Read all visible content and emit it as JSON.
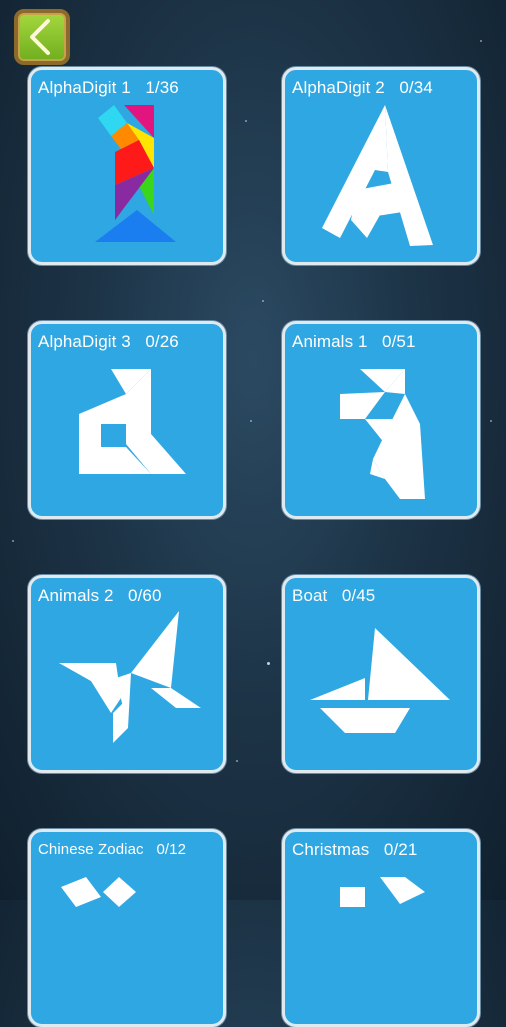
{
  "header": {
    "back_icon": "chevron-left-icon"
  },
  "colors": {
    "card_bg": "#2ea7e2",
    "accent_green": "#7fbf2a"
  },
  "packs": [
    {
      "name": "AlphaDigit 1",
      "progress": "1/36"
    },
    {
      "name": "AlphaDigit 2",
      "progress": "0/34"
    },
    {
      "name": "AlphaDigit 3",
      "progress": "0/26"
    },
    {
      "name": "Animals 1",
      "progress": "0/51"
    },
    {
      "name": "Animals 2",
      "progress": "0/60"
    },
    {
      "name": "Boat",
      "progress": "0/45"
    },
    {
      "name": "Chinese Zodiac",
      "progress": "0/12"
    },
    {
      "name": "Christmas",
      "progress": "0/21"
    }
  ]
}
